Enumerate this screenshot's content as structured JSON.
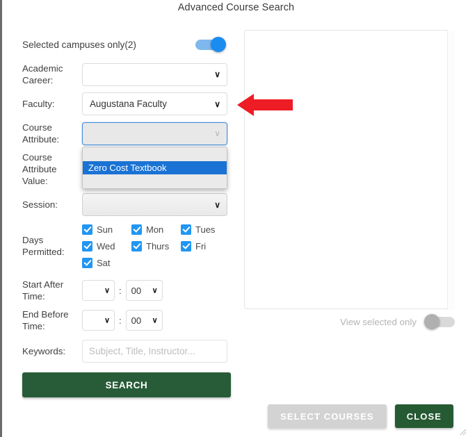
{
  "dialog": {
    "title": "Advanced Course Search"
  },
  "form": {
    "campuses_toggle": {
      "label": "Selected campuses only(2)",
      "state": "on",
      "color": "#1a8cf0"
    },
    "fields": [
      {
        "label": "Academic Career:",
        "value": "",
        "name": "academic-career"
      },
      {
        "label": "Faculty:",
        "value": "Augustana Faculty",
        "name": "faculty"
      },
      {
        "label": "Course Attribute:",
        "value": "",
        "name": "course-attribute"
      },
      {
        "label": "Course Attribute Value:",
        "value": "",
        "name": "course-attribute-value"
      },
      {
        "label": "Session:",
        "value": "",
        "name": "session"
      }
    ],
    "open_dropdown": {
      "field": "course-attribute",
      "options": [
        "",
        "Zero Cost Textbook"
      ],
      "highlighted": "Zero Cost Textbook",
      "highlight_color": "#1a73d4"
    },
    "days": {
      "label": "Days Permitted:",
      "items": [
        {
          "label": "Sun",
          "checked": true
        },
        {
          "label": "Mon",
          "checked": true
        },
        {
          "label": "Tues",
          "checked": true
        },
        {
          "label": "Wed",
          "checked": true
        },
        {
          "label": "Thurs",
          "checked": true
        },
        {
          "label": "Fri",
          "checked": true
        },
        {
          "label": "Sat",
          "checked": true
        }
      ],
      "checkbox_color": "#2196f3"
    },
    "start_time": {
      "label": "Start After Time:",
      "hour": "",
      "separator": ":",
      "minute": "00"
    },
    "end_time": {
      "label": "End Before Time:",
      "hour": "",
      "separator": ":",
      "minute": "00"
    },
    "keywords": {
      "label": "Keywords:",
      "value": "",
      "placeholder": "Subject, Title, Instructor..."
    },
    "search_button": {
      "label": "SEARCH",
      "color": "#285c38"
    }
  },
  "results": {
    "items": [],
    "view_selected_toggle": {
      "label": "View selected only",
      "state": "off"
    }
  },
  "footer": {
    "select_courses": {
      "label": "SELECT COURSES",
      "disabled": true
    },
    "close": {
      "label": "CLOSE",
      "color": "#255a33"
    }
  },
  "annotation": {
    "arrow": {
      "direction": "left",
      "color": "#ee1c25",
      "points_at": "faculty"
    }
  }
}
